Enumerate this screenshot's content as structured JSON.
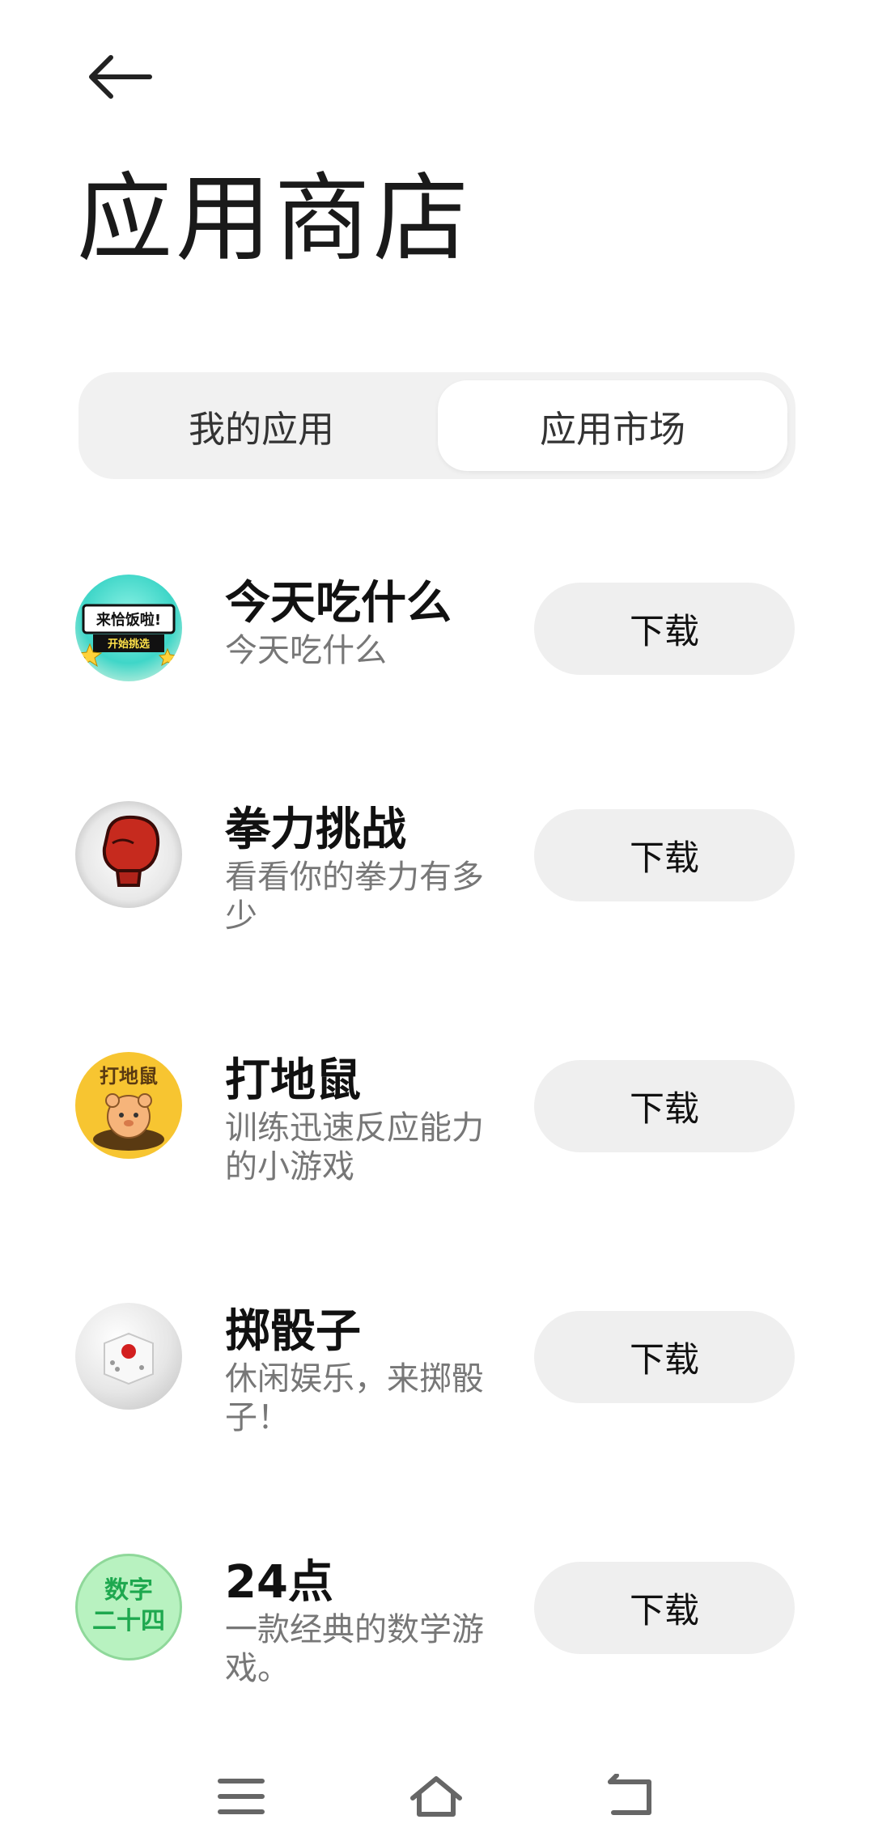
{
  "header": {
    "title": "应用商店"
  },
  "tabs": [
    {
      "label": "我的应用",
      "selected": false
    },
    {
      "label": "应用市场",
      "selected": true
    }
  ],
  "apps": [
    {
      "name": "今天吃什么",
      "desc": "今天吃什么",
      "button": "下载",
      "icon": "food-picker-icon",
      "icon_text": [
        "来恰饭啦!",
        "开始挑选"
      ]
    },
    {
      "name": "拳力挑战",
      "desc": "看看你的拳力有多少",
      "button": "下载",
      "icon": "boxing-glove-icon"
    },
    {
      "name": "打地鼠",
      "desc": "训练迅速反应能力的小游戏",
      "button": "下载",
      "icon": "mole-icon",
      "icon_text": [
        "打地鼠"
      ]
    },
    {
      "name": "掷骰子",
      "desc": "休闲娱乐，来掷骰子！",
      "button": "下载",
      "icon": "dice-icon"
    },
    {
      "name": "24点",
      "desc": "一款经典的数学游戏。",
      "button": "下载",
      "icon": "number-24-icon",
      "icon_text": [
        "数字",
        "二十四"
      ]
    }
  ],
  "navbar": {
    "items": [
      "menu-icon",
      "home-icon",
      "back-icon"
    ]
  },
  "colors": {
    "segment_bg": "#f1f1f1",
    "button_bg": "#efefef",
    "desc_text": "#777777"
  }
}
